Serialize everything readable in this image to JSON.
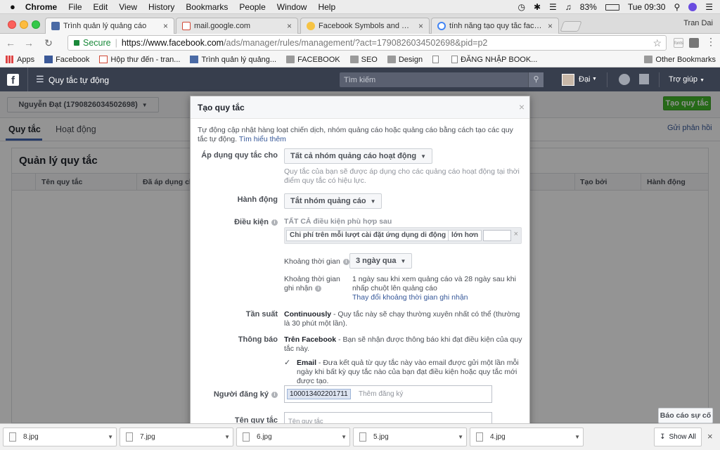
{
  "mac_menu": {
    "app": "Chrome",
    "items": [
      "File",
      "Edit",
      "View",
      "History",
      "Bookmarks",
      "People",
      "Window",
      "Help"
    ],
    "battery": "83%",
    "clock": "Tue 09:30"
  },
  "browser": {
    "tabs": [
      {
        "title": "Trình quản lý quảng cáo",
        "active": true
      },
      {
        "title": "mail.google.com",
        "active": false
      },
      {
        "title": "Facebook Symbols and Chat E",
        "active": false
      },
      {
        "title": "tính năng tạo quy tắc faceboo",
        "active": false
      }
    ],
    "profile_name": "Tran Dai",
    "secure_label": "Secure",
    "url_host": "https://www.facebook.com",
    "url_path": "/ads/manager/rules/management/?act=1790826034502698&pid=p2",
    "bookmarks": [
      {
        "label": "Apps",
        "icon": "apps-grid-icon"
      },
      {
        "label": "Facebook",
        "icon": "facebook-icon"
      },
      {
        "label": "Hộp thư đến - tran...",
        "icon": "gmail-icon"
      },
      {
        "label": "Trình quản lý quảng...",
        "icon": "ads-manager-icon"
      },
      {
        "label": "FACEBOOK",
        "icon": "folder-icon"
      },
      {
        "label": "SEO",
        "icon": "folder-icon"
      },
      {
        "label": "Design",
        "icon": "folder-icon"
      },
      {
        "label": "",
        "icon": "page-icon"
      },
      {
        "label": "ĐĂNG NHẬP BOOK...",
        "icon": "page-icon"
      }
    ],
    "other_bookmarks": "Other Bookmarks"
  },
  "fb_header": {
    "menu_title": "Quy tắc tự động",
    "search_placeholder": "Tìm kiếm",
    "user_name": "Đại",
    "help": "Trợ giúp"
  },
  "page": {
    "account_selector": "Nguyễn Đạt (1790826034502698)",
    "create_rule_button": "Tạo quy tắc",
    "tabs": [
      "Quy tắc",
      "Hoạt động"
    ],
    "feedback_link": "Gửi phản hồi",
    "section_title": "Quản lý quy tắc",
    "table_headers": [
      "Tên quy tắc",
      "Đã áp dụng cho",
      "Tạo bởi",
      "Hành động"
    ],
    "report_button": "Báo cáo sự cố"
  },
  "modal": {
    "title": "Tạo quy tắc",
    "intro": "Tự động cập nhật hàng loạt chiến dịch, nhóm quảng cáo hoặc quảng cáo bằng cách tạo các quy tắc tự động.",
    "learn_more": "Tìm hiểu thêm",
    "apply_label": "Áp dụng quy tắc cho",
    "apply_value": "Tất cả nhóm quảng cáo hoạt động",
    "apply_help": "Quy tắc của bạn sẽ được áp dụng cho các quảng cáo hoạt động tại thời điểm quy tắc có hiệu lực.",
    "action_label": "Hành động",
    "action_value": "Tắt nhóm quảng cáo",
    "condition_label": "Điều kiện",
    "condition_heading": "TẤT CẢ điều kiện phù hợp sau",
    "condition_metric": "Chi phí trên mỗi lượt cài đặt ứng dụng di động",
    "condition_operator": "lớn hơn",
    "condition_value": "",
    "time_range_label": "Khoảng thời gian",
    "time_range_value": "3 ngày qua",
    "attribution_label": "Khoảng thời gian ghi nhận",
    "attribution_value": "1 ngày sau khi xem quảng cáo và 28 ngày sau khi nhấp chuột lên quảng cáo",
    "attribution_change": "Thay đổi khoảng thời gian ghi nhận",
    "frequency_label": "Tần suất",
    "frequency_bold": "Continuously",
    "frequency_text": " - Quy tắc này sẽ chạy thường xuyên nhất có thể (thường là 30 phút một lần).",
    "notify_label": "Thông báo",
    "notify_bold": "Trên Facebook",
    "notify_text": " - Bạn sẽ nhận được thông báo khi đạt điều kiện của quy tắc này.",
    "email_checked": true,
    "email_bold": "Email",
    "email_text": " - Đưa kết quả từ quy tắc này vào email được gửi một lần mỗi ngày khi bất kỳ quy tắc nào của bạn đạt điều kiện hoặc quy tắc mới được tạo.",
    "subscriber_label": "Người đăng ký",
    "subscriber_token": "100013402201711",
    "subscriber_placeholder": "Thêm đăng ký",
    "rule_name_label": "Tên quy tắc",
    "rule_name_placeholder": "Tên quy tắc"
  },
  "downloads": {
    "files": [
      "8.jpg",
      "7.jpg",
      "6.jpg",
      "5.jpg",
      "4.jpg"
    ],
    "show_all": "Show All"
  }
}
